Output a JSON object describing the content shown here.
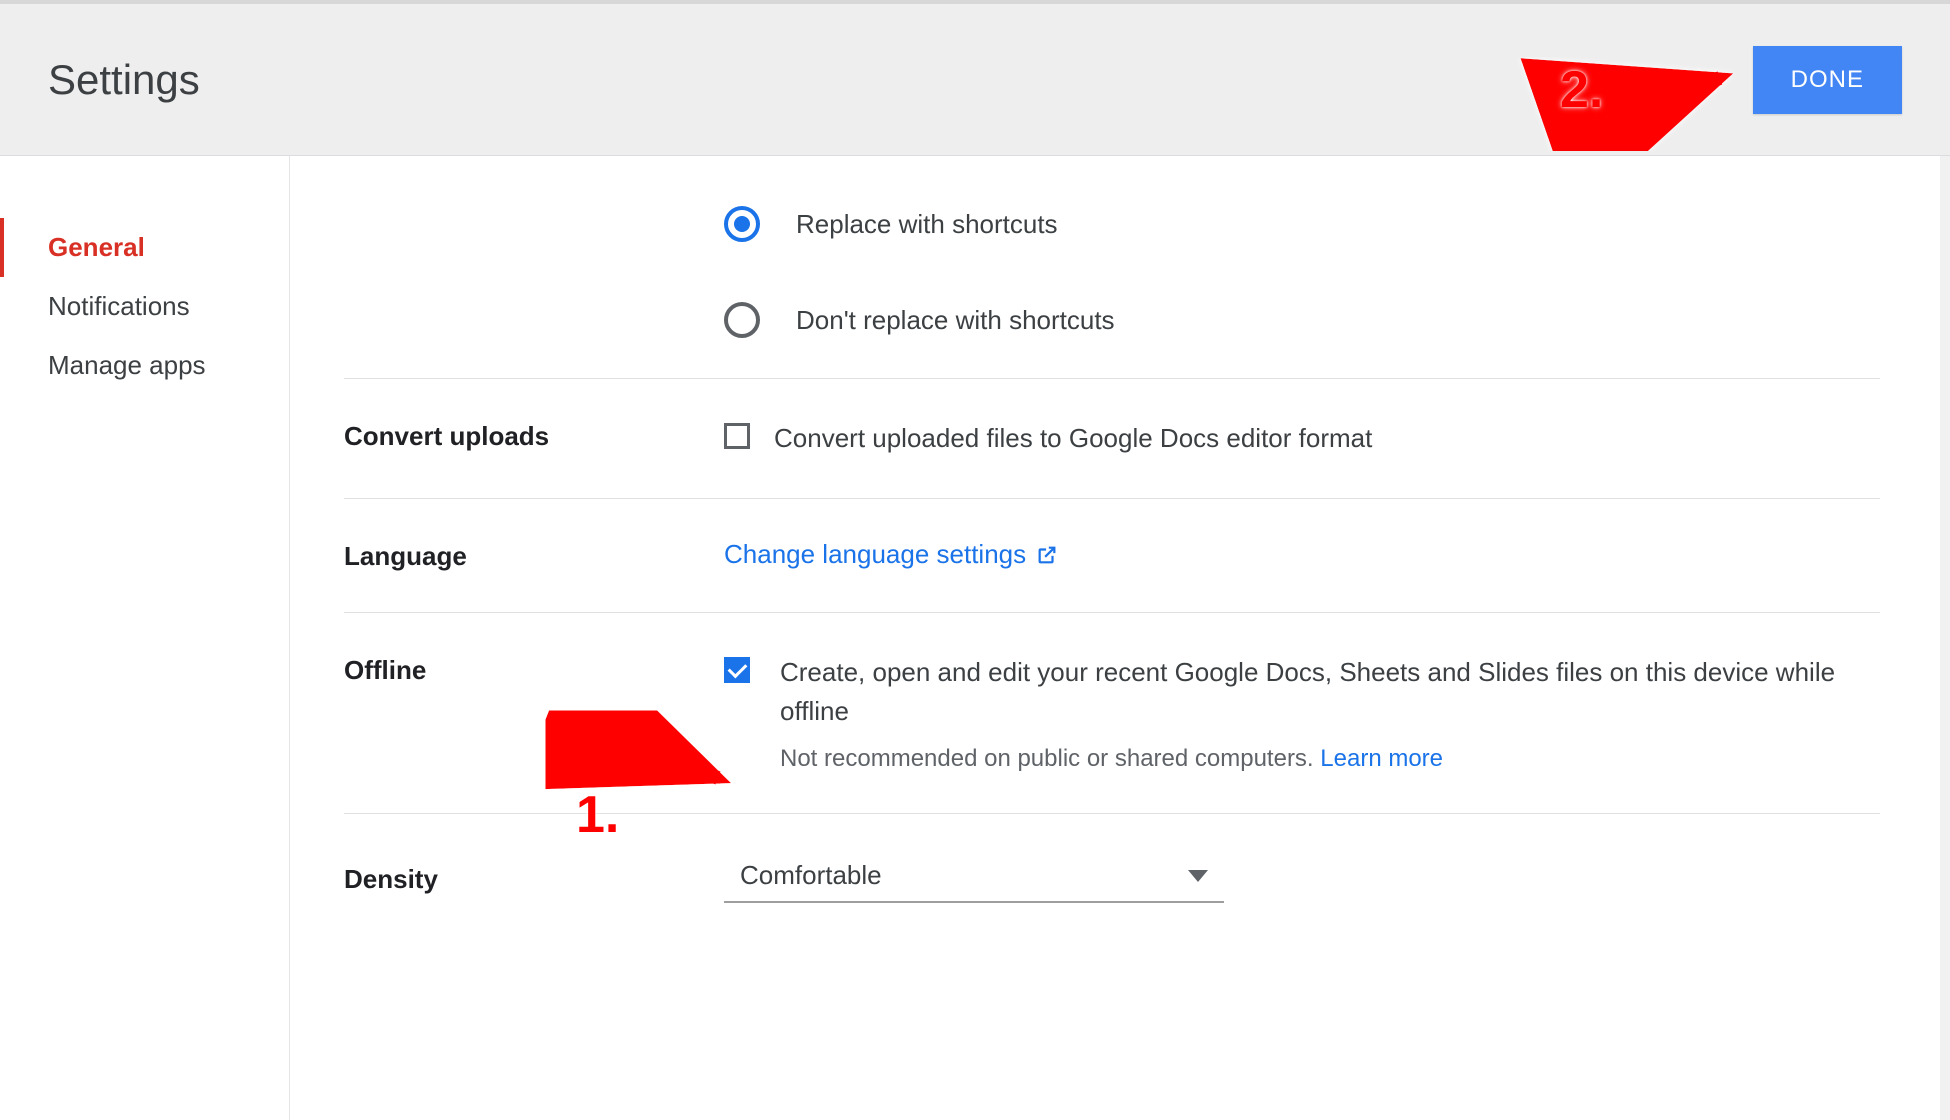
{
  "header": {
    "title": "Settings",
    "done_label": "DONE"
  },
  "sidebar": {
    "items": [
      {
        "label": "General",
        "active": true
      },
      {
        "label": "Notifications",
        "active": false
      },
      {
        "label": "Manage apps",
        "active": false
      }
    ]
  },
  "sections": {
    "shortcuts": {
      "option_replace": "Replace with shortcuts",
      "option_no_replace": "Don't replace with shortcuts",
      "selected": "replace"
    },
    "convert": {
      "label": "Convert uploads",
      "option": "Convert uploaded files to Google Docs editor format",
      "checked": false
    },
    "language": {
      "label": "Language",
      "link_text": "Change language settings"
    },
    "offline": {
      "label": "Offline",
      "text": "Create, open and edit your recent Google Docs, Sheets and Slides files on this device while offline",
      "sub_text": "Not recommended on public or shared computers. ",
      "learn_more": "Learn more",
      "checked": true
    },
    "density": {
      "label": "Density",
      "value": "Comfortable"
    }
  },
  "annotations": {
    "one": "1.",
    "two": "2."
  }
}
